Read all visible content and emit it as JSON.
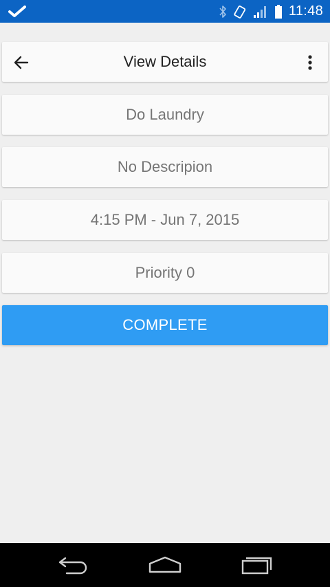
{
  "status_bar": {
    "time": "11:48",
    "background": "#0c64c4",
    "icons": [
      "check-icon",
      "bluetooth-icon",
      "vibrate-icon",
      "signal-icon",
      "battery-icon"
    ]
  },
  "toolbar": {
    "title": "View Details",
    "back_icon": "arrow-left-icon",
    "menu_icon": "more-vertical-icon"
  },
  "details": {
    "name": "Do Laundry",
    "description": "No Descripion",
    "datetime": "4:15 PM - Jun 7, 2015",
    "priority": "Priority 0"
  },
  "actions": {
    "complete_label": "COMPLETE",
    "complete_color": "#2f9cf3"
  },
  "nav_bar": {
    "icons": [
      "back-icon",
      "home-icon",
      "recents-icon"
    ]
  },
  "colors": {
    "background": "#efefef",
    "card": "#fafafa",
    "text_muted": "#757575"
  }
}
